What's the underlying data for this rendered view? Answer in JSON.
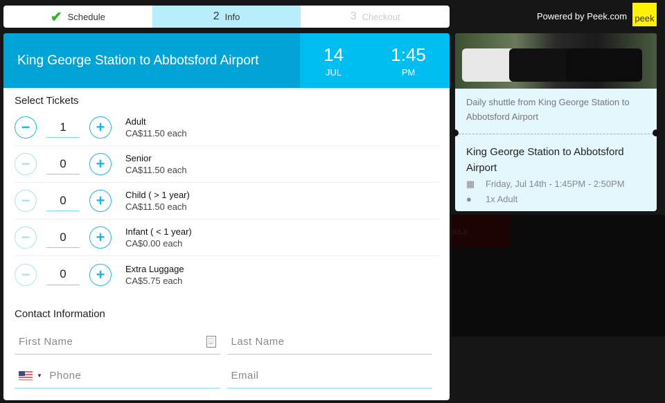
{
  "steps": [
    {
      "label": "Schedule",
      "icon": "check-icon",
      "state": "done"
    },
    {
      "num": "2",
      "label": "Info",
      "state": "active"
    },
    {
      "num": "3",
      "label": "Checkout",
      "state": "disabled"
    }
  ],
  "brand": {
    "powered_by": "Powered by Peek.com",
    "logo": "peek",
    "logo_color": "#fff200"
  },
  "header": {
    "title": "King George Station to Abbotsford Airport",
    "day": "14",
    "month": "JUL",
    "time": "1:45",
    "ampm": "PM",
    "accent": "#00a5d5",
    "accent_light": "#00bdf0"
  },
  "tickets": {
    "title": "Select Tickets",
    "items": [
      {
        "name": "Adult",
        "price": "CA$11.50 each",
        "qty": "1"
      },
      {
        "name": "Senior",
        "price": "CA$11.50 each",
        "qty": "0"
      },
      {
        "name": "Child ( > 1 year)",
        "price": "CA$11.50 each",
        "qty": "0"
      },
      {
        "name": "Infant ( < 1 year)",
        "price": "CA$0.00 each",
        "qty": "0"
      },
      {
        "name": "Extra Luggage",
        "price": "CA$5.75 each",
        "qty": "0"
      }
    ]
  },
  "contact": {
    "title": "Contact Information",
    "first_name": "First Name",
    "last_name": "Last Name",
    "phone": "Phone",
    "email": "Email",
    "country": "US"
  },
  "summary": {
    "description": "Daily shuttle from King George Station to Abbotsford Airport",
    "route": "King George Station to Abbotsford Airport",
    "datetime": "Friday, Jul 14th - 1:45PM - 2:50PM",
    "guests": "1x Adult"
  },
  "background": {
    "partial_text": "ass"
  }
}
